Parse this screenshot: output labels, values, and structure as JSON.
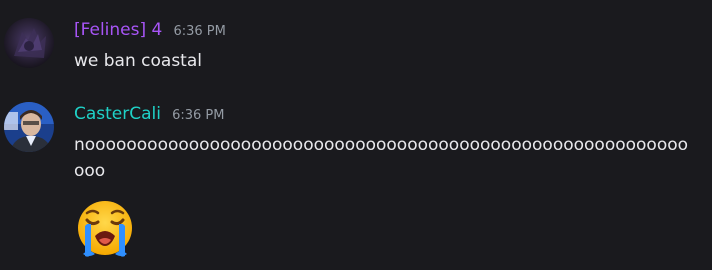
{
  "messages": [
    {
      "username": "[Felines] 4",
      "username_color": "#a855f7",
      "timestamp": "6:36 PM",
      "content": "we ban coastal"
    },
    {
      "username": "CasterCali",
      "username_color": "#1fd1c7",
      "timestamp": "6:36 PM",
      "content": "nooooooooooooooooooooooooooooooooooooooooooooooooooooooooooooo",
      "emoji": "loudly-crying-face"
    }
  ]
}
